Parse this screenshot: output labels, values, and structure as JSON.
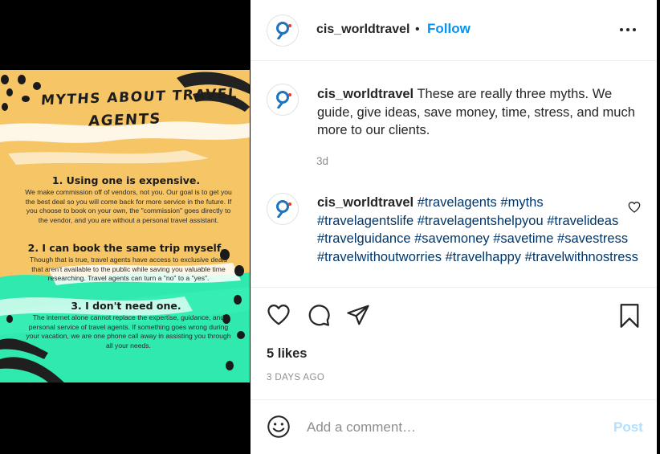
{
  "colors": {
    "accent": "#0095f6",
    "hashtag": "#00376b",
    "muted": "#8e8e8e",
    "image_yellow": "#f6c565",
    "image_green": "#2fe9ae"
  },
  "image": {
    "title_line1": "MYTHS ABOUT TRAVEL",
    "title_line2": "AGENTS",
    "myth1_heading": "1. Using one is expensive.",
    "myth1_body": "We make commission off of vendors, not you. Our goal is to get you the best deal so you will come back for more service in the future. If you choose to book on your own, the \"commission\" goes directly to the vendor, and you are without a personal travel assistant.",
    "myth2_heading": "2. I can book the same trip myself.",
    "myth2_body": "Though that is true, travel agents have access to exclusive deals that aren't available to the public while saving you valuable time researching. Travel agents can turn a \"no\" to a \"yes\".",
    "myth3_heading": "3. I don't need one.",
    "myth3_body": "The internet alone cannot replace the expertise, guidance, and personal service of travel agents. If something goes wrong during your vacation, we are one phone call away in assisting you through all your needs."
  },
  "header": {
    "username": "cis_worldtravel",
    "separator": "•",
    "follow_label": "Follow",
    "more_icon": "more-options-icon"
  },
  "caption": {
    "username": "cis_worldtravel",
    "text": "These are really three myths. We guide, give ideas, save money, time, stress, and much more to our clients.",
    "time": "3d"
  },
  "comment2": {
    "username": "cis_worldtravel",
    "hashtags": [
      "#travelagents",
      "#myths",
      "#travelagentslife",
      "#travelagentshelpyou",
      "#travelideas",
      "#travelguidance",
      "#savemoney",
      "#savetime",
      "#savestress",
      "#travelwithoutworries",
      "#travelhappy",
      "#travelwithnostress"
    ]
  },
  "actions": {
    "icons": [
      "heart-icon",
      "comment-icon",
      "share-icon",
      "bookmark-icon"
    ],
    "likes": "5 likes",
    "date": "3 DAYS AGO"
  },
  "add_comment": {
    "placeholder": "Add a comment…",
    "post_label": "Post",
    "emoji_icon": "smiley-icon"
  }
}
